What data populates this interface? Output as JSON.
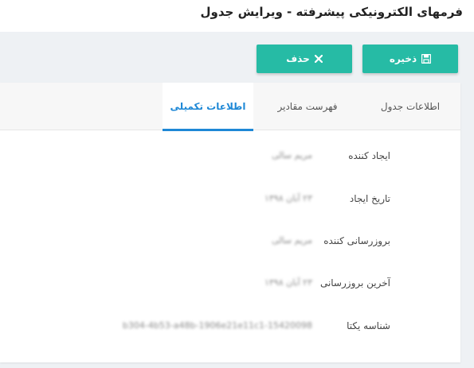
{
  "header": {
    "title": "فرمهای الکترونیکی پیشرفته - ویرایش جدول"
  },
  "toolbar": {
    "save_label": "ذخیره",
    "delete_label": "حذف"
  },
  "tabs": [
    {
      "label": "اطلاعات جدول",
      "active": false
    },
    {
      "label": "فهرست مقادیر",
      "active": false
    },
    {
      "label": "اطلاعات تکمیلی",
      "active": true
    }
  ],
  "details": [
    {
      "label": "ایجاد کننده",
      "value": "مریم سالی"
    },
    {
      "label": "تاریخ ایجاد",
      "value": "۲۳ آبان ۱۳۹۸"
    },
    {
      "label": "بروزرسانی کننده",
      "value": "مریم سالی"
    },
    {
      "label": "آخرین بروزرسانی",
      "value": "۲۳ آبان ۱۳۹۸"
    },
    {
      "label": "شناسه یکتا",
      "value": "b304-4b53-a48b-1906e21e11c1-15420098"
    }
  ],
  "colors": {
    "accent": "#26bba5",
    "active_tab": "#1e88d6",
    "content_bg": "#eef1f4"
  }
}
